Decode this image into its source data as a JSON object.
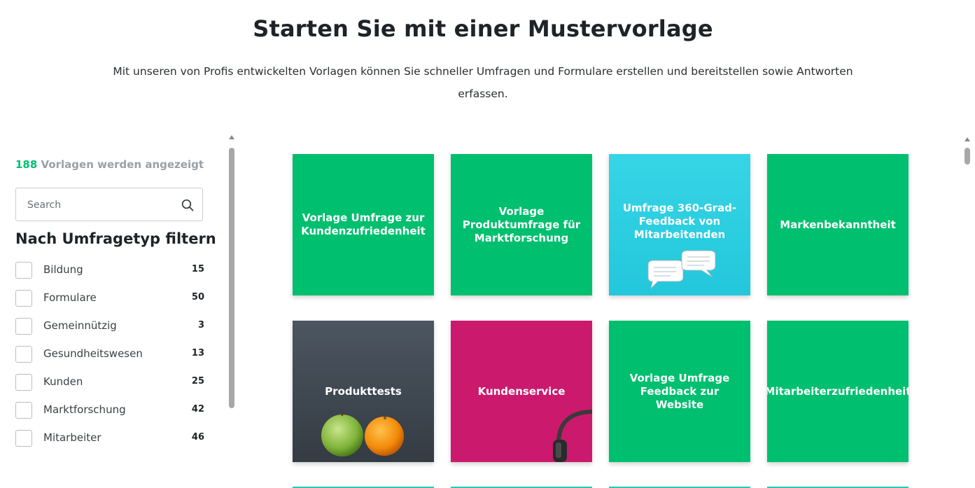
{
  "header": {
    "title": "Starten Sie mit einer Mustervorlage",
    "subtitle": "Mit unseren von Profis entwickelten Vorlagen können Sie schneller Umfragen und Formulare erstellen und bereitstellen sowie Antworten erfassen."
  },
  "sidebar": {
    "count_number": "188",
    "count_text": "Vorlagen werden angezeigt",
    "search_placeholder": "Search",
    "filter_title": "Nach Umfragetyp filtern",
    "filters": [
      {
        "label": "Bildung",
        "count": "15"
      },
      {
        "label": "Formulare",
        "count": "50"
      },
      {
        "label": "Gemeinnützig",
        "count": "3"
      },
      {
        "label": "Gesundheitswesen",
        "count": "13"
      },
      {
        "label": "Kunden",
        "count": "25"
      },
      {
        "label": "Marktforschung",
        "count": "42"
      },
      {
        "label": "Mitarbeiter",
        "count": "46"
      }
    ]
  },
  "cards": [
    {
      "title": "Vorlage Umfrage zur Kundenzufriedenheit",
      "color": "#00bf6f"
    },
    {
      "title": "Vorlage Produktumfrage für Marktforschung",
      "color": "#00bf6f"
    },
    {
      "title": "Umfrage 360-Grad-Feedback von Mitarbeitenden",
      "color": "#2ed0e2",
      "icon": "speech-bubbles-icon"
    },
    {
      "title": "Markenbekanntheit",
      "color": "#00bf6f"
    },
    {
      "title": "Produkttests",
      "color": "#3f4750",
      "icon": "apple-orange-icon"
    },
    {
      "title": "Kundenservice",
      "color": "#cb1a6e",
      "icon": "headset-icon"
    },
    {
      "title": "Vorlage Umfrage Feedback zur Website",
      "color": "#00bf6f"
    },
    {
      "title": "Mitarbeiterzufriedenheit",
      "color": "#00bf6f"
    }
  ],
  "icons": {
    "search": "search-icon"
  },
  "colors": {
    "accent": "#00bf6f",
    "count_muted": "#9aa0a6"
  }
}
